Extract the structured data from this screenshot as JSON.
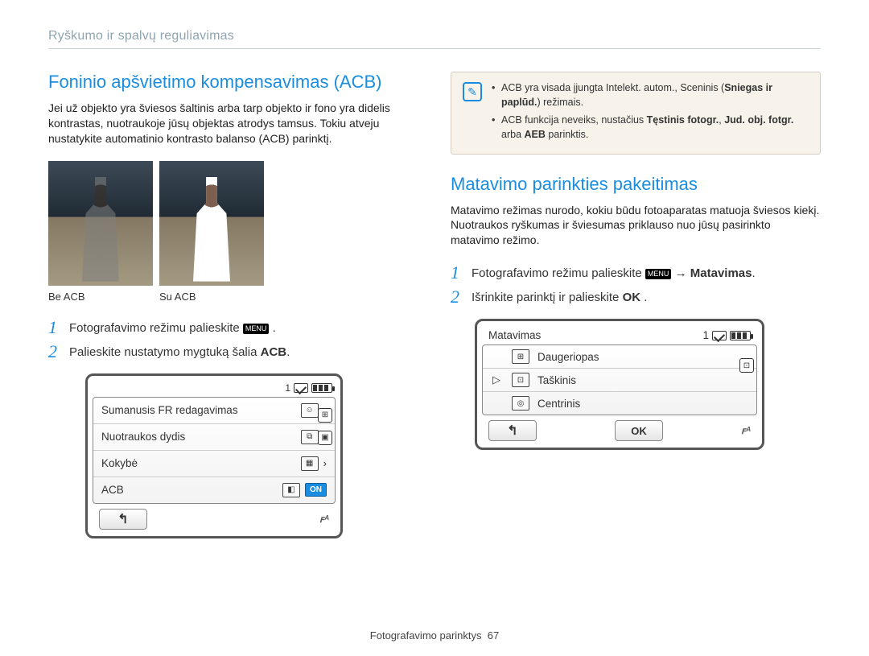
{
  "breadcrumb": "Ryškumo ir spalvų reguliavimas",
  "left": {
    "heading": "Foninio apšvietimo kompensavimas (ACB)",
    "intro": "Jei už objekto yra šviesos šaltinis arba tarp objekto ir fono yra didelis kontrastas, nuotraukoje jūsų objektas atrodys tamsus. Tokiu atveju nustatykite automatinio kontrasto balanso (ACB) parinktį.",
    "photo_labels": {
      "a": "Be ACB",
      "b": "Su ACB"
    },
    "steps": {
      "s1_pre": "Fotografavimo režimu palieskite ",
      "s1_chip": "MENU",
      "s1_post": " .",
      "s2_pre": "Palieskite nustatymo mygtuką šalia ",
      "s2_bold": "ACB",
      "s2_post": "."
    },
    "panel": {
      "status_count": "1",
      "rows": {
        "r1": "Sumanusis FR redagavimas",
        "r2": "Nuotraukos dydis",
        "r3": "Kokybė",
        "r4": "ACB"
      },
      "on_label": "ON",
      "flash_label": "ꜰᴬ"
    }
  },
  "note": {
    "bullet1_pre": "ACB yra visada įjungta Intelekt. autom., Sceninis (",
    "bullet1_bold": "Sniegas ir paplūd.",
    "bullet1_post": ") režimais.",
    "bullet2_pre": "ACB funkcija neveiks, nustačius ",
    "bullet2_bold1": "Tęstinis fotogr.",
    "bullet2_mid": ", ",
    "bullet2_bold2": "Jud. obj. fotgr.",
    "bullet2_mid2": " arba ",
    "bullet2_bold3": "AEB",
    "bullet2_post": " parinktis."
  },
  "right": {
    "heading": "Matavimo parinkties pakeitimas",
    "intro": "Matavimo režimas nurodo, kokiu būdu fotoaparatas matuoja šviesos kiekį. Nuotraukos ryškumas ir šviesumas priklauso nuo jūsų pasirinkto matavimo režimo.",
    "steps": {
      "s1_pre": "Fotografavimo režimu palieskite ",
      "s1_chip": "MENU",
      "s1_arrow": " → ",
      "s1_bold": "Matavimas",
      "s1_post": ".",
      "s2_pre": "Išrinkite parinktį ir palieskite ",
      "s2_ok": "OK",
      "s2_post": " ."
    },
    "panel": {
      "title": "Matavimas",
      "status_count": "1",
      "options": {
        "o1": "Daugeriopas",
        "o2": "Taškinis",
        "o3": "Centrinis"
      },
      "ok_label": "OK",
      "flash_label": "ꜰᴬ"
    }
  },
  "footer": {
    "label": "Fotografavimo parinktys",
    "page": "67"
  }
}
